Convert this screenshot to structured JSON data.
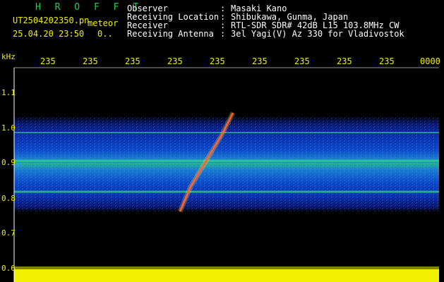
{
  "header": {
    "brand": "H R O F F T",
    "filename": "UT2504202350.pn",
    "meteor_label": "meteor",
    "datetime": "25.04.20 23:50",
    "datetime_suffix": "0..",
    "meta": [
      {
        "key": "Observer",
        "value": "Masaki Kano"
      },
      {
        "key": "Receiving Location",
        "value": "Shibukawa, Gunma, Japan"
      },
      {
        "key": "Receiver",
        "value": "RTL-SDR SDR# 42dB L15 103.8MHz CW"
      },
      {
        "key": "Receiving Antenna",
        "value": "3el Yagi(V) Az 330 for Vladivostok"
      }
    ]
  },
  "axis": {
    "unit": "kHz",
    "x_ticks": [
      "235",
      "235",
      "235",
      "235",
      "235",
      "235",
      "235",
      "235",
      "235",
      "0000"
    ],
    "y_ticks": [
      "1.1",
      "1.0",
      "0.9",
      "0.8",
      "0.7",
      "0.6"
    ]
  },
  "colors": {
    "background": "#000000",
    "label_yellow": "#f0f000",
    "brand_green": "#1fd14a",
    "band_blue": "#0a2a9a",
    "trace_red": "#ff3030"
  }
}
